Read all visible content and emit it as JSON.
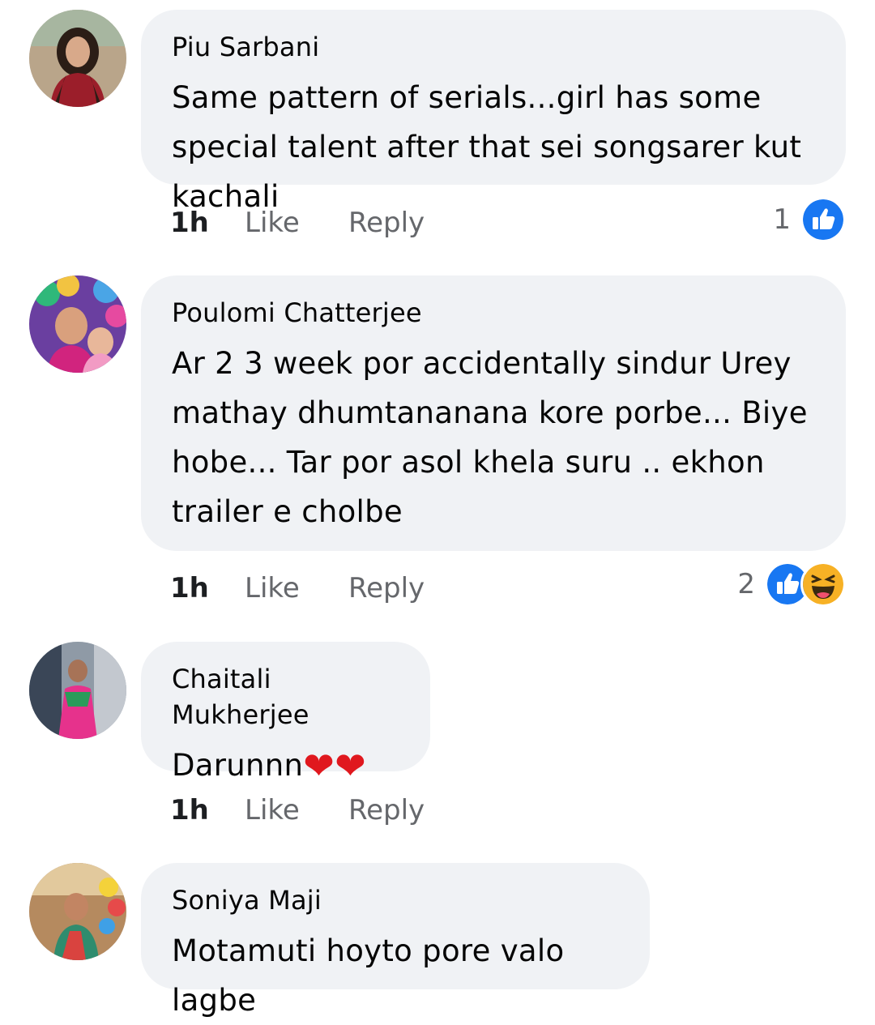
{
  "comments": [
    {
      "author": "Piu Sarbani",
      "text": "Same pattern of serials...girl has some special talent after that sei songsarer kut kachali",
      "time": "1h",
      "like_label": "Like",
      "reply_label": "Reply",
      "reaction_count": "1",
      "reactions": [
        "like-icon"
      ]
    },
    {
      "author": "Poulomi Chatterjee",
      "text": "Ar 2 3 week por accidentally sindur Urey mathay dhumtananana kore porbe... Biye hobe... Tar por asol khela suru .. ekhon trailer e cholbe",
      "time": "1h",
      "like_label": "Like",
      "reply_label": "Reply",
      "reaction_count": "2",
      "reactions": [
        "like-icon",
        "haha-icon"
      ]
    },
    {
      "author": "Chaitali Mukherjee",
      "text": "Darunnn",
      "hearts": [
        "❤",
        "❤"
      ],
      "time": "1h",
      "like_label": "Like",
      "reply_label": "Reply"
    },
    {
      "author": "Soniya Maji",
      "text": "Motamuti hoyto pore valo lagbe"
    }
  ],
  "colors": {
    "bubble": "#f0f2f5",
    "like_blue": "#1877f2",
    "haha_yellow": "#f7b125",
    "muted_text": "#65676b"
  }
}
